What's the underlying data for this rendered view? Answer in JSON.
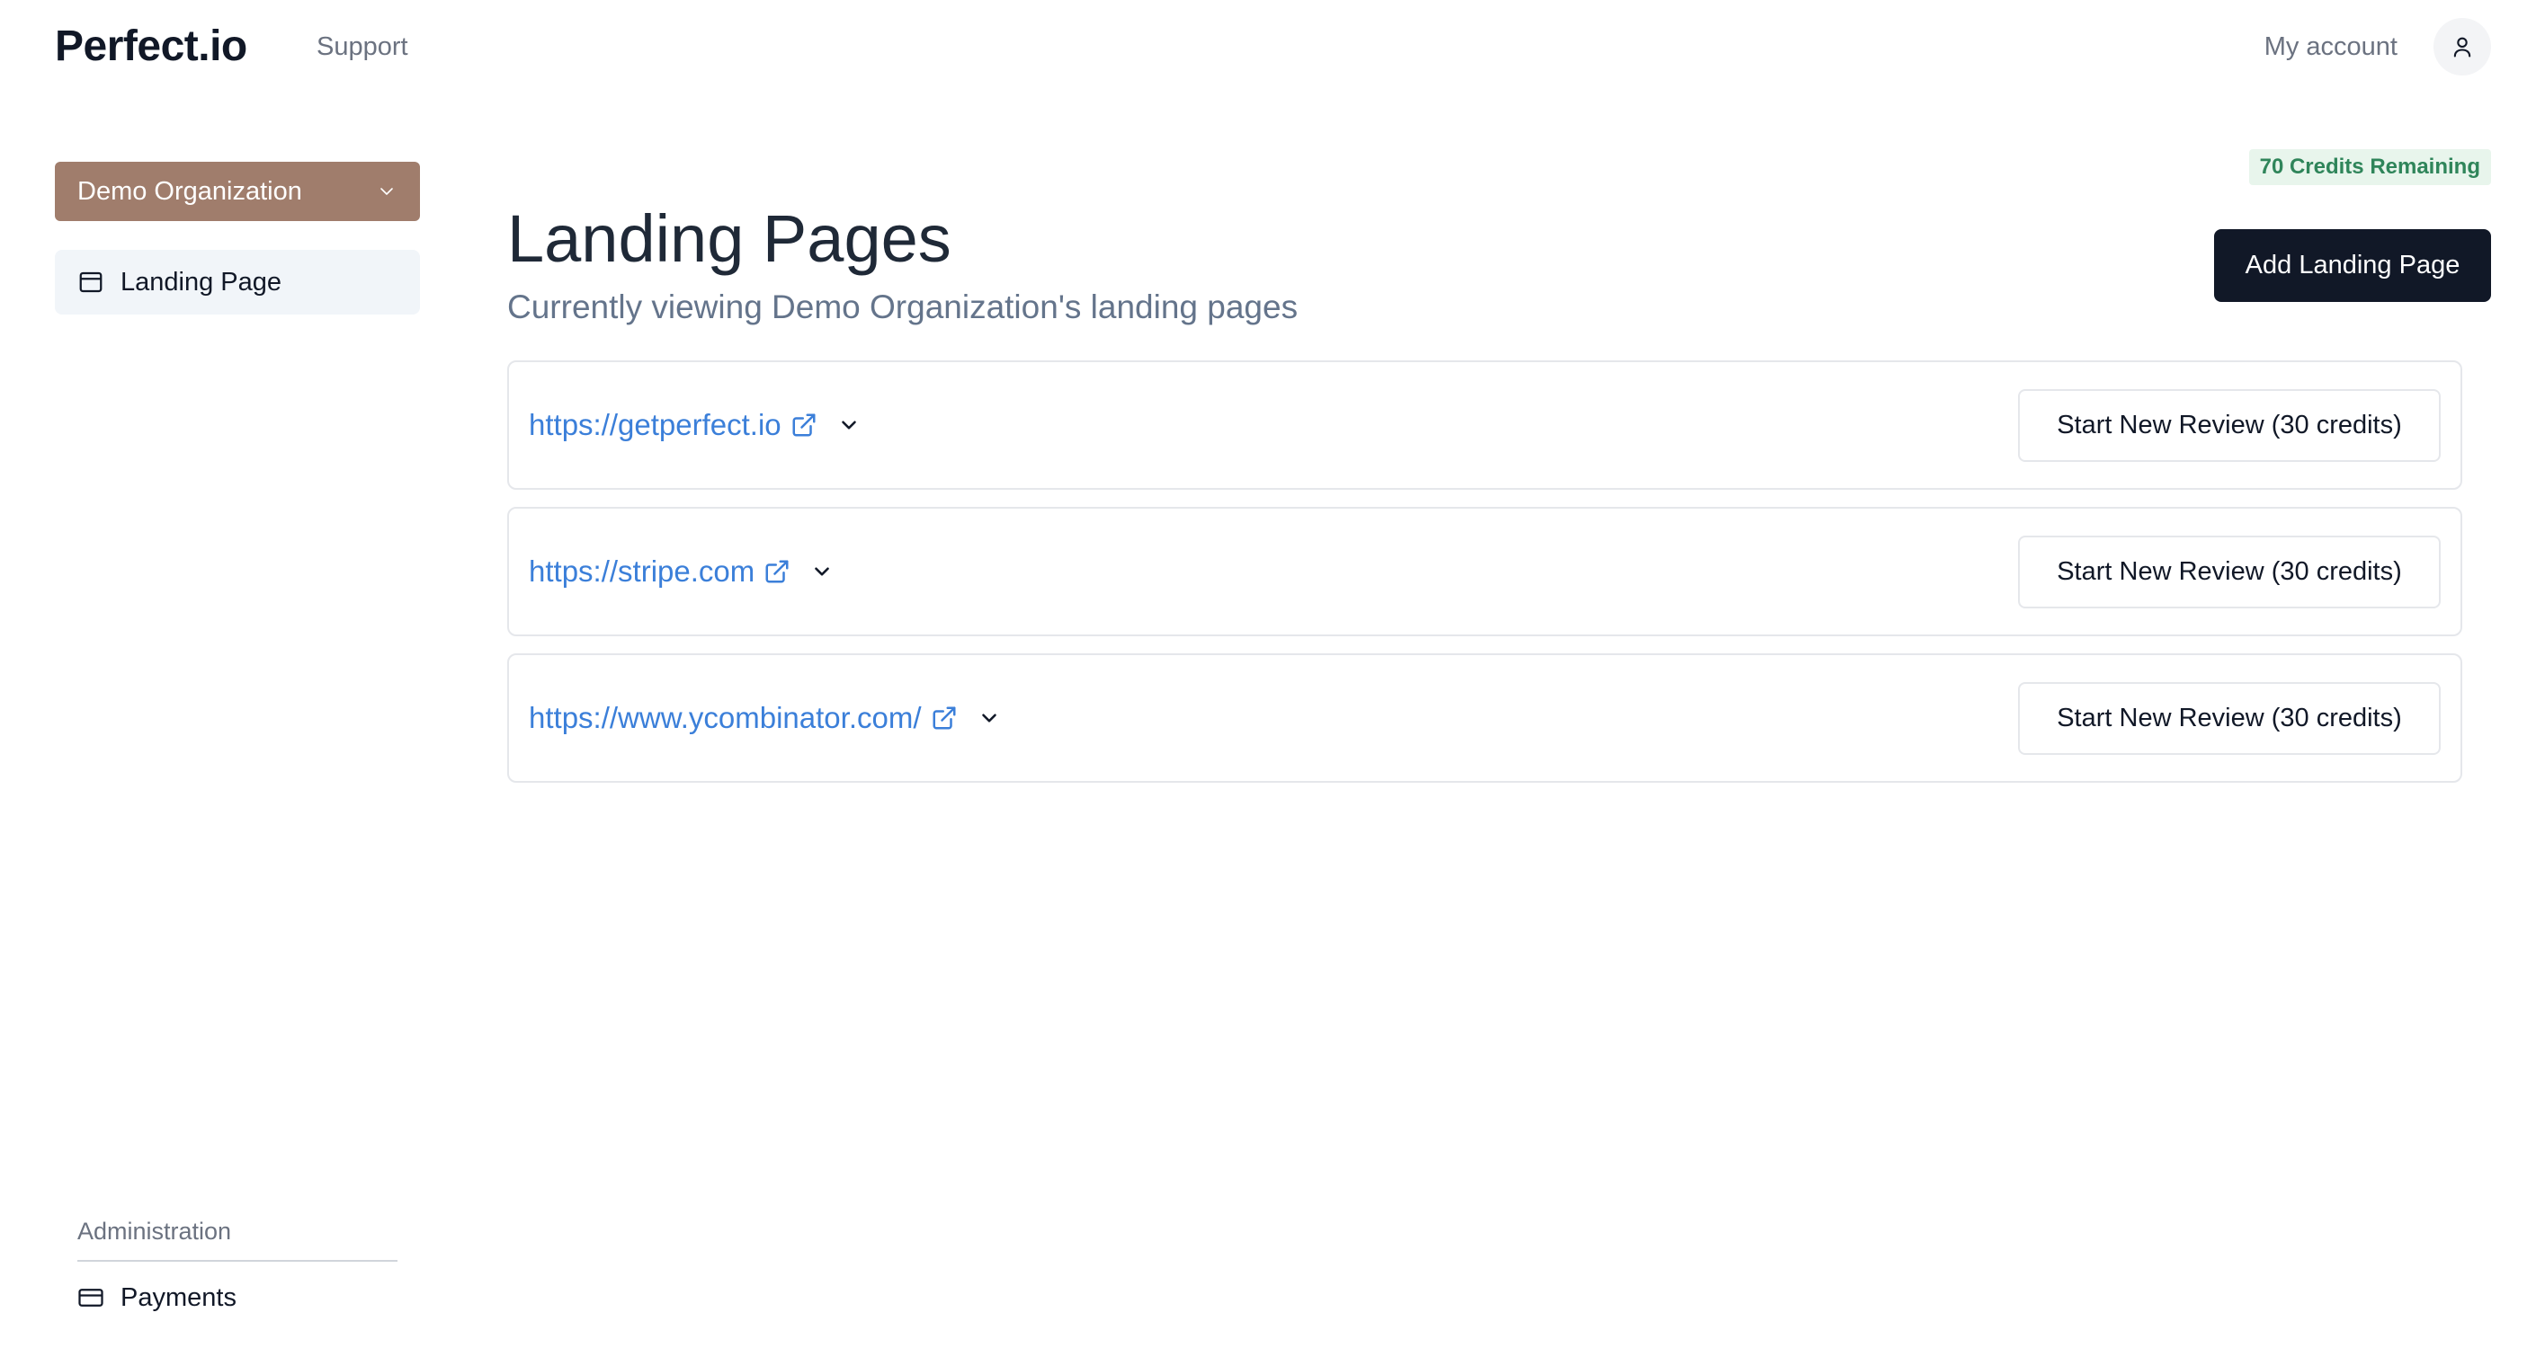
{
  "header": {
    "logo": "Perfect.io",
    "support_label": "Support",
    "account_label": "My account",
    "avatar_icon": "user-icon"
  },
  "sidebar": {
    "org_selector": {
      "value": "Demo Organization",
      "icon": "chevron-down-icon"
    },
    "items": [
      {
        "label": "Landing Page",
        "icon": "browser-window-icon",
        "active": true
      }
    ],
    "admin": {
      "section_label": "Administration",
      "items": [
        {
          "label": "Payments",
          "icon": "credit-card-icon"
        }
      ]
    }
  },
  "main": {
    "credits_badge": "70 Credits Remaining",
    "title": "Landing Pages",
    "subtitle": "Currently viewing Demo Organization's landing pages",
    "add_button_label": "Add Landing Page",
    "pages": [
      {
        "url": "https://getperfect.io",
        "review_label": "Start New Review (30 credits)"
      },
      {
        "url": "https://stripe.com",
        "review_label": "Start New Review (30 credits)"
      },
      {
        "url": "https://www.ycombinator.com/",
        "review_label": "Start New Review (30 credits)"
      }
    ]
  },
  "colors": {
    "org_selector_bg": "#a07d6c",
    "primary_button_bg": "#111827",
    "link": "#3b7fd9",
    "badge_bg": "#e8f5ec",
    "badge_text": "#2f855a",
    "active_nav_bg": "#f1f5f9"
  }
}
